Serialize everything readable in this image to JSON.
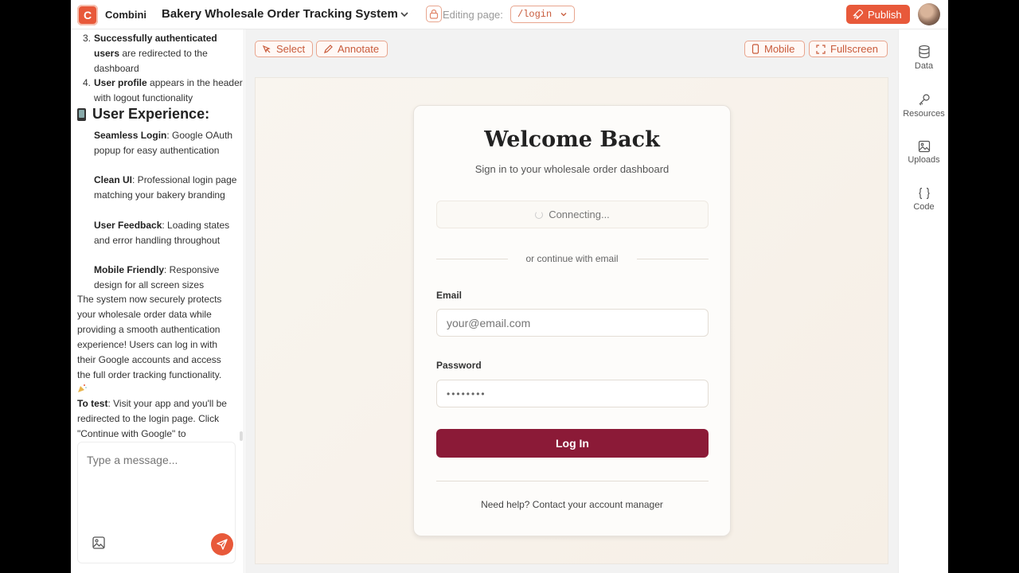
{
  "topbar": {
    "logo_letter": "C",
    "brand": "Combini",
    "project_title": "Bakery Wholesale Order Tracking System",
    "editing_label": "Editing page:",
    "page_path": "/login",
    "publish_label": "Publish"
  },
  "chat": {
    "list_items": [
      {
        "num": "3.",
        "bold": "Successfully authenticated users",
        "rest": " are redirected to the dashboard"
      },
      {
        "num": "4.",
        "bold": "User profile",
        "rest": " appears in the header with logout functionality"
      }
    ],
    "ux_heading": "User Experience:",
    "ux_items": [
      {
        "bold": "Seamless Login",
        "rest": ": Google OAuth popup for easy authentication"
      },
      {
        "bold": "Clean UI",
        "rest": ": Professional login page matching your bakery branding"
      },
      {
        "bold": "User Feedback",
        "rest": ": Loading states and error handling throughout"
      },
      {
        "bold": "Mobile Friendly",
        "rest": ": Responsive design for all screen sizes"
      }
    ],
    "summary": "The system now securely protects your wholesale order data while providing a smooth authentication experience! Users can log in with their Google accounts and access the full order tracking functionality.",
    "test_bold": "To test",
    "test_rest": ": Visit your app and you'll be redirected to the login page. Click \"Continue with Google\" to",
    "input_placeholder": "Type a message..."
  },
  "preview_toolbar": {
    "select": "Select",
    "annotate": "Annotate",
    "mobile": "Mobile",
    "fullscreen": "Fullscreen"
  },
  "login_card": {
    "title": "Welcome Back",
    "subtitle": "Sign in to your wholesale order dashboard",
    "connecting": "Connecting...",
    "divider_text": "or continue with email",
    "email_label": "Email",
    "email_placeholder": "your@email.com",
    "password_label": "Password",
    "password_value": "••••••••",
    "login_button": "Log In",
    "help_text": "Need help? Contact your account manager"
  },
  "rail": {
    "items": [
      {
        "label": "Data",
        "icon": "database-icon"
      },
      {
        "label": "Resources",
        "icon": "key-icon"
      },
      {
        "label": "Uploads",
        "icon": "image-icon"
      },
      {
        "label": "Code",
        "icon": "braces-icon"
      }
    ]
  },
  "colors": {
    "accent": "#e8593a",
    "login_button": "#8b1a37"
  }
}
